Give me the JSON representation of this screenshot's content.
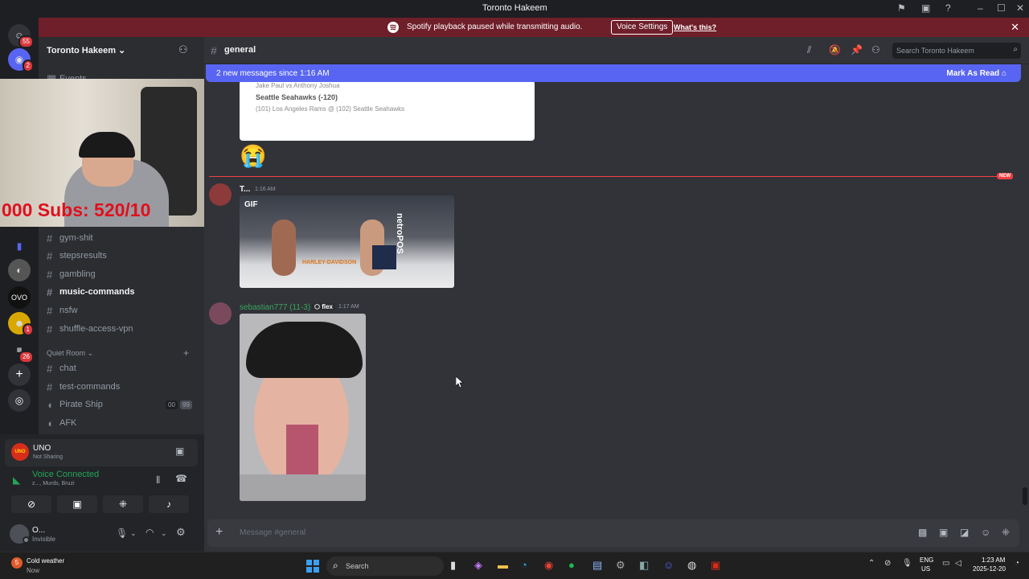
{
  "window": {
    "title": "Toronto Hakeem",
    "controls": [
      "–",
      "☐",
      "✕"
    ]
  },
  "banner": {
    "text": "Spotify playback paused while transmitting audio.",
    "button": "Voice Settings",
    "link": "What's this?"
  },
  "servers": [
    {
      "badge": "55"
    },
    {
      "badge": "2"
    },
    {
      "badge": "1"
    },
    {
      "badge": "26"
    }
  ],
  "sidebar": {
    "guild": "Toronto Hakeem",
    "events": "Events",
    "channels": [
      "gym-shit",
      "stepsresults",
      "gambling",
      "music-commands",
      "nsfw",
      "shuffle-access-vpn"
    ],
    "quiet_room": "Quiet Room",
    "voice_channels": [
      "chat",
      "test-commands"
    ],
    "pirate_ship": "Pirate Ship",
    "pirate_counts": [
      "00",
      "99"
    ],
    "afk": "AFK"
  },
  "webcam": {
    "subs_text": "000 Subs: 520/10"
  },
  "activity": {
    "name": "UNO",
    "status": "Not Sharing",
    "icon_text": "UNO"
  },
  "voice": {
    "status": "Voice Connected",
    "members": "z..., Murds, Bruzi"
  },
  "user": {
    "name": "O...",
    "status": "Invisible"
  },
  "chat": {
    "channel": "general",
    "search_placeholder": "Search Toronto Hakeem",
    "new_messages": "2 new messages since 1:16 AM",
    "mark_read": "Mark As Read",
    "new_label": "NEW",
    "embed_lines": [
      "Jake Paul vs Anthony Joshua",
      "Seattle Seahawks (-120)",
      "(101) Los Angeles Rams @ (102) Seattle Seahawks"
    ],
    "emoji": "😭",
    "msg1": {
      "author": "T...",
      "time": "1:16 AM",
      "gif_label": "GIF",
      "sponsor": "netroPOS",
      "banner": "HARLEY-DAVIDSON"
    },
    "msg2": {
      "author": "sebastian777 (11-3)",
      "tag": "flex",
      "time": "1:17 AM"
    },
    "input_placeholder": "Message #general"
  },
  "taskbar": {
    "weather_title": "Cold weather",
    "weather_sub": "Now",
    "weather_badge": "5",
    "search": "Search",
    "lang": "ENG",
    "region": "US",
    "time": "1:23 AM",
    "date": "2025-12-20"
  }
}
